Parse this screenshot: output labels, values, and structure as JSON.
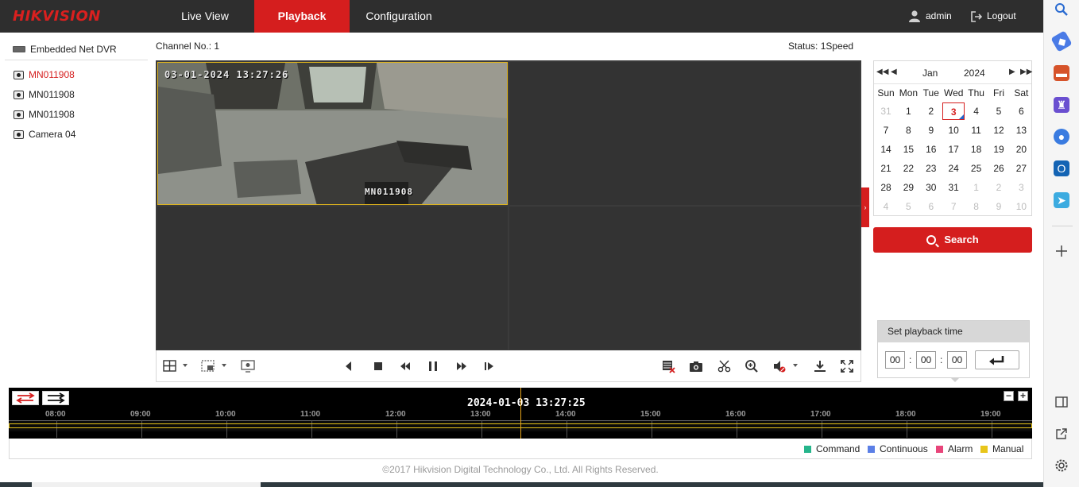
{
  "brand": {
    "logo_text": "HIKVISION",
    "accent": "#d51e1e"
  },
  "nav": {
    "tabs": [
      {
        "label": "Live View",
        "active": false
      },
      {
        "label": "Playback",
        "active": true
      },
      {
        "label": "Configuration",
        "active": false
      }
    ],
    "user": "admin",
    "logout": "Logout"
  },
  "tree": {
    "root": "Embedded Net DVR",
    "cameras": [
      {
        "label": "MN011908",
        "active": true
      },
      {
        "label": "MN011908",
        "active": false
      },
      {
        "label": "MN011908",
        "active": false
      },
      {
        "label": "Camera 04",
        "active": false
      }
    ]
  },
  "header": {
    "channel": "Channel No.: 1",
    "status": "Status: 1Speed"
  },
  "video": {
    "osd_time": "03-01-2024 13:27:26",
    "osd_name": "MN011908"
  },
  "calendar": {
    "month": "Jan",
    "year": "2024",
    "weekdays": [
      "Sun",
      "Mon",
      "Tue",
      "Wed",
      "Thu",
      "Fri",
      "Sat"
    ],
    "weeks": [
      [
        "31",
        "1",
        "2",
        "3",
        "4",
        "5",
        "6"
      ],
      [
        "7",
        "8",
        "9",
        "10",
        "11",
        "12",
        "13"
      ],
      [
        "14",
        "15",
        "16",
        "17",
        "18",
        "19",
        "20"
      ],
      [
        "21",
        "22",
        "23",
        "24",
        "25",
        "26",
        "27"
      ],
      [
        "28",
        "29",
        "30",
        "31",
        "1",
        "2",
        "3"
      ],
      [
        "4",
        "5",
        "6",
        "7",
        "8",
        "9",
        "10"
      ]
    ],
    "selected_day": "3"
  },
  "search": {
    "label": "Search"
  },
  "playback_time": {
    "title": "Set playback time",
    "hh": "00",
    "mm": "00",
    "ss": "00"
  },
  "timeline": {
    "current": "2024-01-03 13:27:25",
    "hours": [
      "08:00",
      "09:00",
      "10:00",
      "11:00",
      "12:00",
      "13:00",
      "14:00",
      "15:00",
      "16:00",
      "17:00",
      "18:00",
      "19:00"
    ]
  },
  "legend": [
    {
      "label": "Command",
      "color": "#26b58b"
    },
    {
      "label": "Continuous",
      "color": "#5b7fe6"
    },
    {
      "label": "Alarm",
      "color": "#e8457a"
    },
    {
      "label": "Manual",
      "color": "#e8c51a"
    }
  ],
  "footer": {
    "copyright": "©2017 Hikvision Digital Technology Co., Ltd. All Rights Reserved."
  }
}
